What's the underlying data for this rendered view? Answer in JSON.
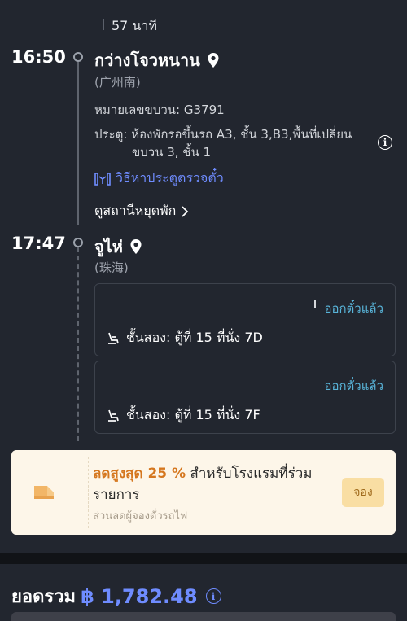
{
  "journey": {
    "duration": "57 นาที",
    "departure": {
      "time": "16:50",
      "station": "กว่างโจวหนาน",
      "station_cn": "(广州南)",
      "train_no_label": "หมายเลขขบวน:",
      "train_no": "G3791",
      "gate_label": "ประตู:",
      "gate_line1": "ห้องพักรอขึ้นรถ A3, ชั้น 3,B3,พื้นที่เปลี่ยน",
      "gate_line2": "ขบวน 3, ชั้น 1",
      "gate_link": "วิธีหาประตูตรวจตั๋ว",
      "view_stops": "ดูสถานีหยุดพัก"
    },
    "arrival": {
      "time": "17:47",
      "station": "จูไห่",
      "station_cn": "(珠海)"
    }
  },
  "seats": [
    {
      "status": "ออกตั๋วแล้ว",
      "detail": "ชั้นสอง: ตู้ที่ 15 ที่นั่ง 7D"
    },
    {
      "status": "ออกตั๋วแล้ว",
      "detail": "ชั้นสอง: ตู้ที่ 15 ที่นั่ง 7F"
    }
  ],
  "promo": {
    "highlight": "ลดสูงสุด 25 %",
    "text": " สำหรับโรงแรมที่ร่วมรายการ",
    "subtext": "ส่วนลดผู้จองตั๋วรถไฟ",
    "button": "จอง"
  },
  "footer": {
    "total_label": "ยอดรวม",
    "total_amount": "฿ 1,782.48"
  },
  "icons": {
    "pin": "location-pin-icon",
    "info": "info-icon",
    "gate": "ticket-gate-icon",
    "chevron": "chevron-right-icon",
    "seat": "seat-icon",
    "hotel": "hotel-bed-icon"
  },
  "colors": {
    "background": "#22262f",
    "accent_blue": "#6f8cff",
    "status_teal": "#58b3d8",
    "promo_orange": "#d5771f",
    "promo_bg": "#fdf6e9"
  }
}
